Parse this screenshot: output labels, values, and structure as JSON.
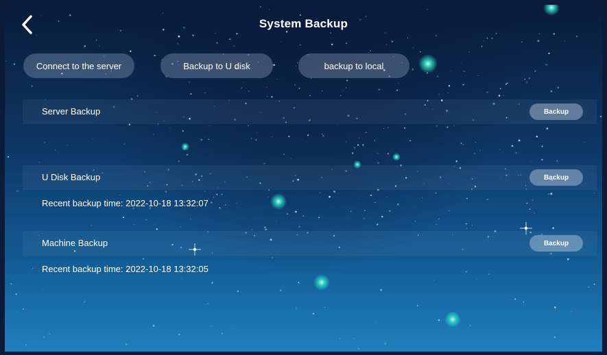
{
  "header": {
    "title": "System Backup",
    "back_icon": "chevron-left-icon"
  },
  "tabs": [
    {
      "label": "Connect to the server"
    },
    {
      "label": "Backup to U disk"
    },
    {
      "label": "backup to local"
    }
  ],
  "sections": [
    {
      "label": "Server Backup",
      "button": "Backup"
    },
    {
      "label": "U Disk Backup",
      "button": "Backup",
      "recent": "Recent backup time: 2022-10-18 13:32:07"
    },
    {
      "label": "Machine Backup",
      "button": "Backup",
      "recent": "Recent backup time: 2022-10-18 13:32:05"
    }
  ],
  "colors": {
    "background_top": "#0a1b3a",
    "background_bottom": "#1f80bd",
    "star_glow": "#2fe0c8",
    "text": "#ffffff"
  }
}
